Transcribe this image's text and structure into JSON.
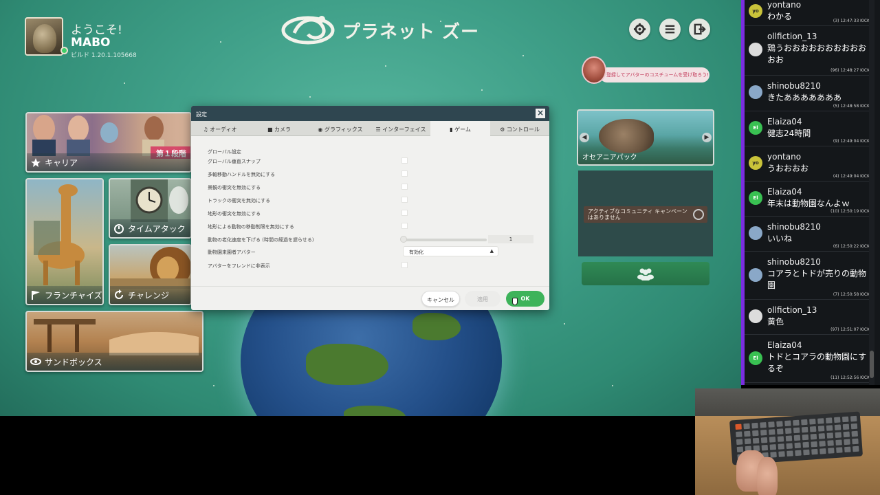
{
  "profile": {
    "welcome": "ようこそ!",
    "username": "MABO",
    "build": "ビルド 1.20.1.105668"
  },
  "logo": {
    "text": "プラネット ズー"
  },
  "top_icons": [
    "gear-icon",
    "menu-icon",
    "exit-icon"
  ],
  "campaign_bubble": "登録してアバターのコスチュームを受け取ろう!",
  "modes": {
    "career": {
      "label": "キャリア",
      "badge": "第１段階"
    },
    "time_attack": {
      "label": "タイムアタック"
    },
    "franchise": {
      "label": "フランチャイズ"
    },
    "challenge": {
      "label": "チャレンジ"
    },
    "sandbox": {
      "label": "サンドボックス"
    }
  },
  "featured": {
    "label": "オセアニアパック"
  },
  "community": {
    "message": "アクティブなコミュニティ キャンペーンはありません"
  },
  "dialog": {
    "title": "設定",
    "tabs": [
      {
        "label": "オーディオ",
        "icon": "music-icon"
      },
      {
        "label": "カメラ",
        "icon": "camera-icon"
      },
      {
        "label": "グラフィックス",
        "icon": "palette-icon"
      },
      {
        "label": "インターフェイス",
        "icon": "list-icon"
      },
      {
        "label": "ゲーム",
        "icon": "chart-icon",
        "active": true
      },
      {
        "label": "コントロール",
        "icon": "gear-icon"
      }
    ],
    "section_title": "グローバル設定",
    "options": {
      "grid_snap": "グローバル垂直スナップ",
      "multi_move": "多軸移動ハンドルを無効にする",
      "scenery_collision": "景観の衝突を無効にする",
      "track_collision": "トラックの衝突を無効にする",
      "terrain_collision": "地形の衝突を無効にする",
      "terrain_movement": "地形による動物の移動制限を無効にする",
      "aging": "動物の老化速度を下げる (時間の経過を遅らせる)",
      "zookeeper_avatar": "動物園来園者アバター",
      "hide_avatar": "アバターをフレンドに非表示"
    },
    "aging_value": "1",
    "avatar_select": "有効化",
    "buttons": {
      "cancel": "キャンセル",
      "apply": "適用",
      "ok": "OK"
    }
  },
  "chat": {
    "messages": [
      {
        "initials": "yo",
        "user": "yontano",
        "text": "わかる",
        "meta": "(3)  12:47:33  KICK",
        "color": "#c9c33a"
      },
      {
        "initials": "",
        "user": "ollfiction_13",
        "text": "鶏うおおおおおおおおおおおお",
        "meta": "(96)  12:48:27  KICK",
        "color": "#dcdcdc"
      },
      {
        "initials": "",
        "user": "shinobu8210",
        "text": "きたあああああああ",
        "meta": "(5)  12:48:58  KICK",
        "color": "#8aa8c8"
      },
      {
        "initials": "El",
        "user": "Elaiza04",
        "text": "健志24時間",
        "meta": "(9)  12:49:04  KICK",
        "color": "#39c152"
      },
      {
        "initials": "yo",
        "user": "yontano",
        "text": "うおおおお",
        "meta": "(4)  12:49:04  KICK",
        "color": "#c9c33a"
      },
      {
        "initials": "El",
        "user": "Elaiza04",
        "text": "年末は動物園なんよｗ",
        "meta": "(10)  12:50:19  KICK",
        "color": "#39c152"
      },
      {
        "initials": "",
        "user": "shinobu8210",
        "text": "いいね",
        "meta": "(6)  12:50:22  KICK",
        "color": "#8aa8c8"
      },
      {
        "initials": "",
        "user": "shinobu8210",
        "text": "コアラとトドが売りの動物園",
        "meta": "(7)  12:50:58  KICK",
        "color": "#8aa8c8"
      },
      {
        "initials": "",
        "user": "ollfiction_13",
        "text": "黄色",
        "meta": "(97)  12:51:07  KICK",
        "color": "#dcdcdc"
      },
      {
        "initials": "El",
        "user": "Elaiza04",
        "text": "トドとコアラの動物園にするぞ",
        "meta": "(11)  12:52:56  KICK",
        "color": "#39c152"
      }
    ]
  },
  "colors": {
    "accent_green": "#3db35a",
    "chat_accent": "#7a2ee0",
    "badge_pink": "#d64a6a"
  }
}
